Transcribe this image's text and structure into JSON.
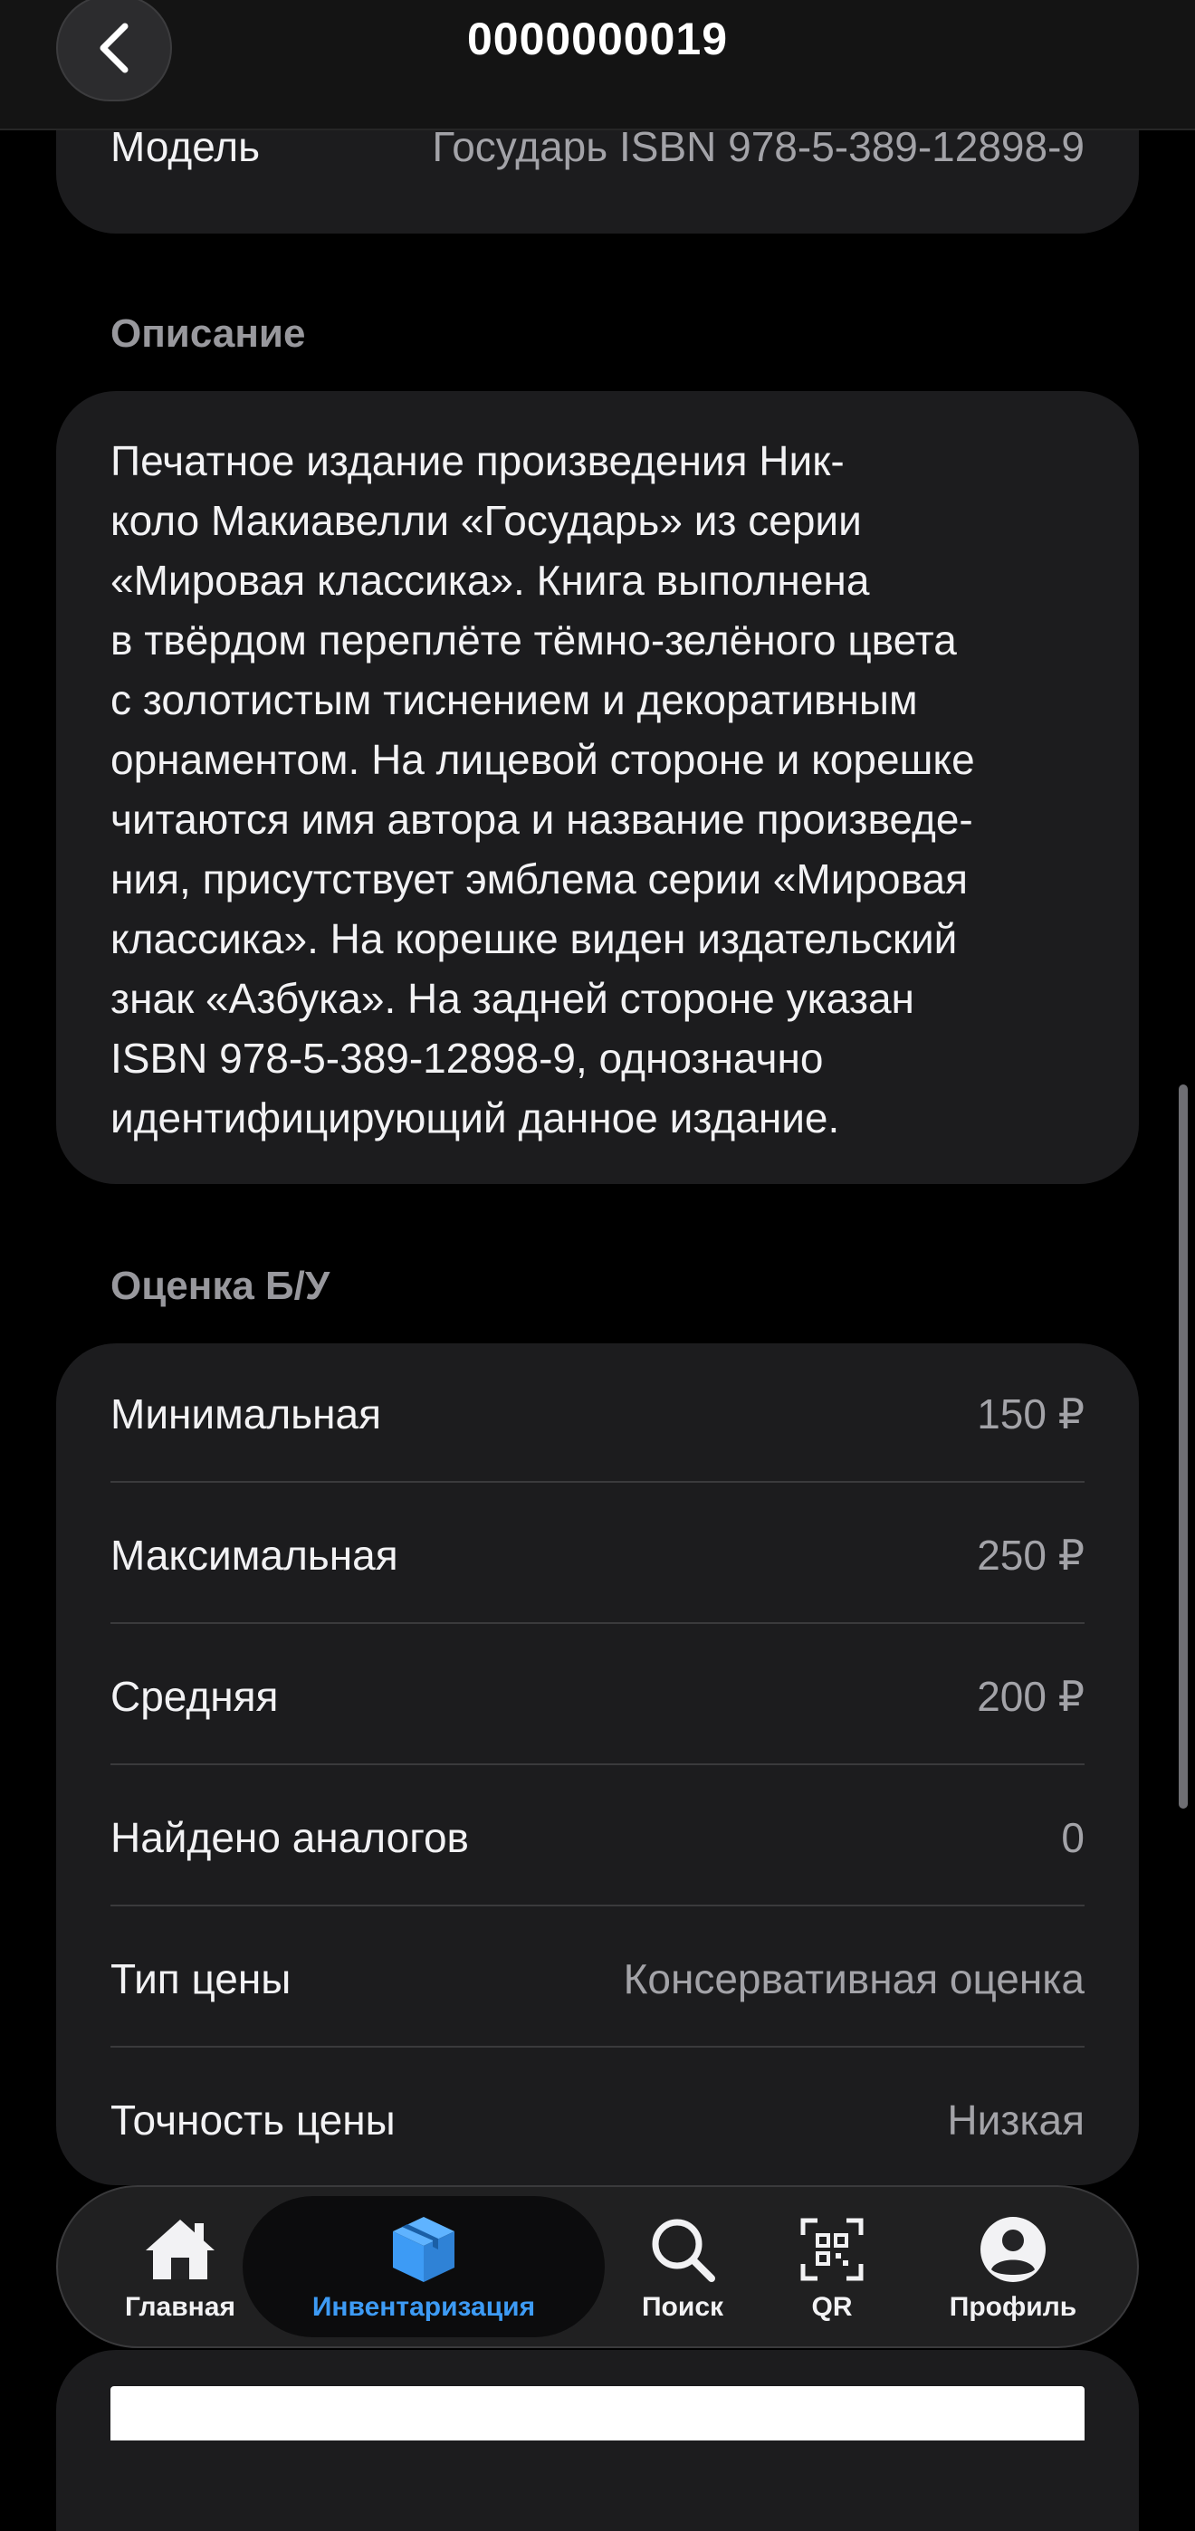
{
  "header": {
    "title": "0000000019",
    "back_icon": "chevron-left-icon"
  },
  "model": {
    "label": "Модель",
    "value": "Государь ISBN 978-5-389-12898-9"
  },
  "description": {
    "title": "Описание",
    "lines": [
      "Печатное издание произведения Ник-",
      "коло Макиавелли «Государь» из серии",
      "«Мировая классика». Книга выполнена",
      "в твёрдом переплёте тёмно-зелёного цвета",
      "с золотистым тиснением и декоративным",
      "орнаментом. На лицевой стороне и корешке",
      "читаются имя автора и название произведе-",
      "ния, присутствует эмблема серии «Мировая",
      "классика». На корешке виден издательский",
      "знак «Азбука». На задней стороне указан",
      "ISBN 978-5-389-12898-9, однозначно",
      "идентифицирующий данное издание."
    ]
  },
  "estimate": {
    "title": "Оценка Б/У",
    "rows": [
      {
        "label": "Минимальная",
        "value": "150 ₽"
      },
      {
        "label": "Максимальная",
        "value": "250 ₽"
      },
      {
        "label": "Средняя",
        "value": "200 ₽"
      },
      {
        "label": "Найдено аналогов",
        "value": "0"
      },
      {
        "label": "Тип цены",
        "value": "Консервативная оценка"
      },
      {
        "label": "Точность цены",
        "value": "Низкая"
      }
    ]
  },
  "tabbar": {
    "items": [
      {
        "label": "Главная",
        "icon": "house-icon"
      },
      {
        "label": "Инвентаризация",
        "icon": "box-icon",
        "active": true
      },
      {
        "label": "Поиск",
        "icon": "search-icon"
      },
      {
        "label": "QR",
        "icon": "qr-code-icon"
      },
      {
        "label": "Профиль",
        "icon": "profile-icon"
      }
    ]
  },
  "colors": {
    "background": "#000000",
    "card": "#1c1c1e",
    "accent": "#3d9bf5",
    "secondary_text": "#a3a3a8"
  }
}
